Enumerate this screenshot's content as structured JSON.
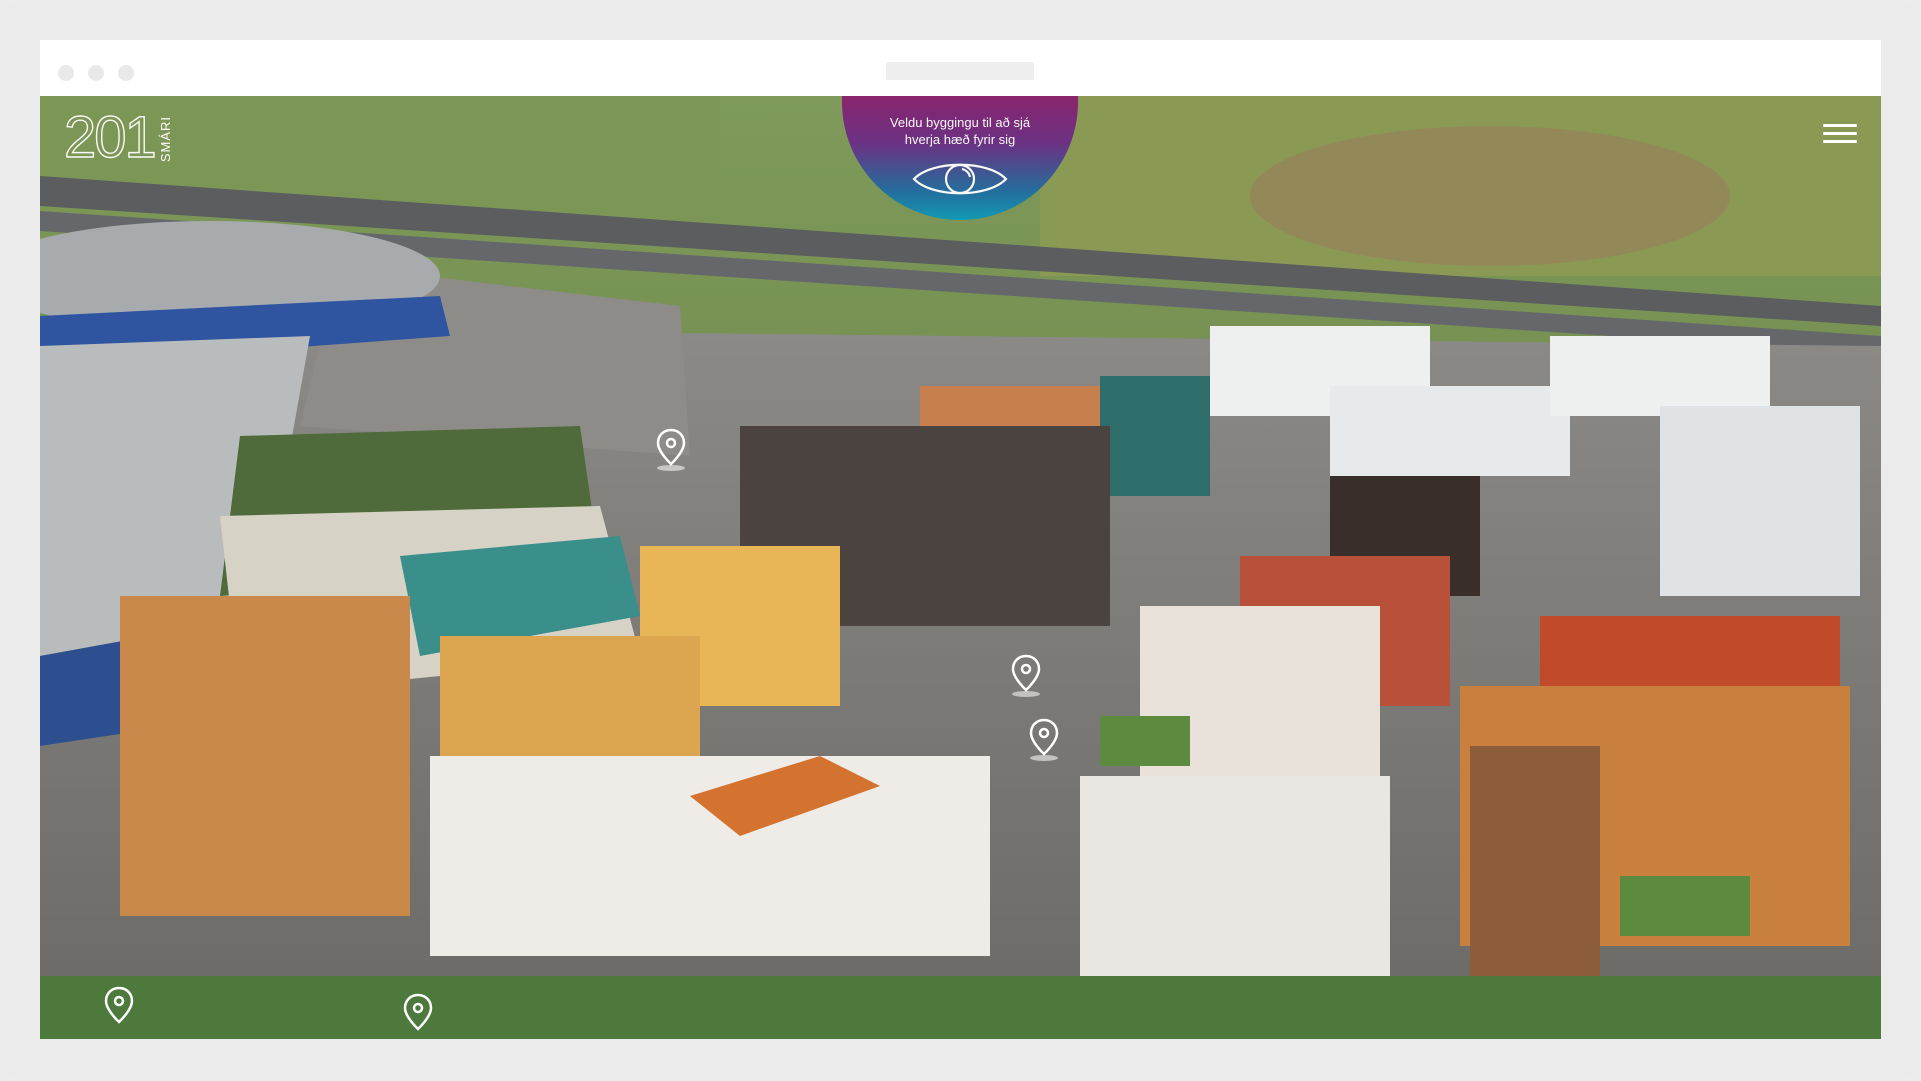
{
  "hint": {
    "line1": "Veldu byggingu til að sjá",
    "line2": "hverja hæð fyrir sig",
    "icon": "eye-icon"
  },
  "logo": {
    "number": "201",
    "word": "SMÁRI"
  },
  "menu": {
    "icon": "hamburger-menu-icon"
  },
  "pins": {
    "icon": "map-pin-icon"
  },
  "colors": {
    "hint_top": "#8a1f6e",
    "hint_bottom": "#0e9ab8",
    "frame": "#ebebeb"
  }
}
